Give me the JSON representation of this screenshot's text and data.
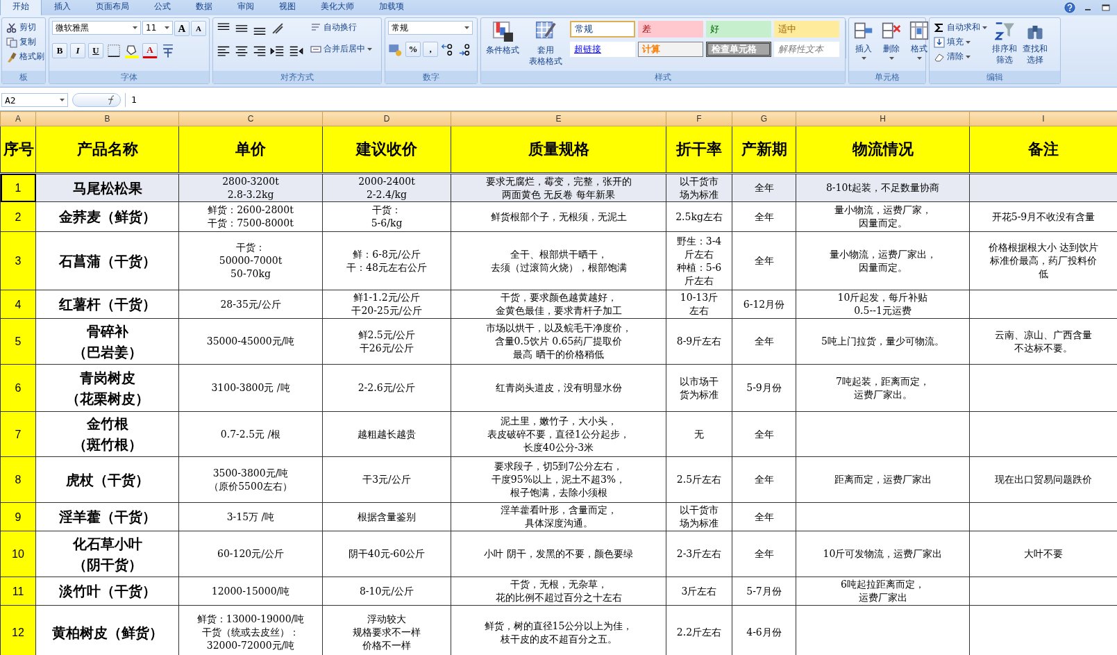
{
  "tabs": [
    {
      "label": "开始",
      "selected": true
    },
    {
      "label": "插入",
      "selected": false
    },
    {
      "label": "页面布局",
      "selected": false
    },
    {
      "label": "公式",
      "selected": false
    },
    {
      "label": "数据",
      "selected": false
    },
    {
      "label": "审阅",
      "selected": false
    },
    {
      "label": "视图",
      "selected": false
    },
    {
      "label": "美化大师",
      "selected": false
    },
    {
      "label": "加载项",
      "selected": false
    }
  ],
  "ribbon": {
    "clipboard": {
      "label": "板",
      "items": [
        "剪切",
        "复制",
        "格式刷"
      ]
    },
    "font": {
      "label": "字体",
      "font": "微软雅黑",
      "size": "11",
      "grow": "A",
      "shrink": "A",
      "bold": "B",
      "italic": "I",
      "underline": "U",
      "font_color": "A"
    },
    "alignment": {
      "label": "对齐方式",
      "wrap": "自动换行",
      "merge": "合并后居中"
    },
    "number": {
      "label": "数字",
      "format": "常规",
      "percent": "%",
      "comma": ","
    },
    "styles": {
      "label": "样式",
      "buttons": [
        [
          "条件格式"
        ],
        [
          "套用",
          "表格格式"
        ]
      ],
      "cells": [
        {
          "label": "常规",
          "kind": "normal"
        },
        {
          "label": "差",
          "kind": "bad"
        },
        {
          "label": "好",
          "kind": "good"
        },
        {
          "label": "适中",
          "kind": "neutral"
        },
        {
          "label": "超链接",
          "kind": "hyperlink"
        },
        {
          "label": "计算",
          "kind": "calculation"
        },
        {
          "label": "检查单元格",
          "kind": "check"
        },
        {
          "label": "解释性文本",
          "kind": "explanatory"
        }
      ]
    },
    "cells": {
      "label": "单元格",
      "buttons": [
        "插入",
        "删除",
        "格式"
      ]
    },
    "editing": {
      "label": "编辑",
      "items": [
        "自动求和",
        "填充",
        "清除"
      ],
      "buttons": [
        [
          "排序和",
          "筛选"
        ],
        [
          "查找和",
          "选择"
        ]
      ]
    }
  },
  "formula_bar": {
    "name_box": "A2",
    "formula": "1"
  },
  "sheet": {
    "column_letters": [
      "A",
      "B",
      "C",
      "D",
      "E",
      "F",
      "G",
      "H",
      "I"
    ],
    "header": [
      "序号",
      "产品名称",
      "单价",
      "建议收价",
      "质量规格",
      "折干率",
      "产新期",
      "物流情况",
      "备注"
    ],
    "rows": [
      {
        "selected": true,
        "cells": [
          [
            "1"
          ],
          [
            "马尾松松果"
          ],
          [
            "2800-3200t",
            "2.8-3.2kg"
          ],
          [
            "2000-2400t",
            "2-2.4/kg"
          ],
          [
            "要求无腐烂，霉变，完整，张开的",
            "两面黄色 无反卷 每年新果"
          ],
          [
            "以干货市",
            "场为标准"
          ],
          [
            "全年"
          ],
          [
            "8-10t起装，不足数量协商"
          ],
          []
        ]
      },
      {
        "selected": false,
        "cells": [
          [
            "2"
          ],
          [
            "金荞麦（鲜货）"
          ],
          [
            "鲜货：2600-2800t",
            "干货：7500-8000t"
          ],
          [
            "干货：",
            "5-6/kg"
          ],
          [
            "鲜货根部个子，无根须，无泥土"
          ],
          [
            "2.5kg左右"
          ],
          [
            "全年"
          ],
          [
            "量小物流，运费厂家，",
            "因量而定。"
          ],
          [
            "开花5-9月不收没有含量"
          ]
        ]
      },
      {
        "selected": false,
        "cells": [
          [
            "3"
          ],
          [
            "石菖蒲（干货）"
          ],
          [
            "干货：",
            "50000-7000t",
            "50-70kg"
          ],
          [
            "鲜：6-8元/公斤",
            "干：48元左右公斤"
          ],
          [
            "全干、根部烘干晒干，",
            "去须（过滚筒火烧），根部饱满"
          ],
          [
            "野生：3-4",
            "斤左右",
            "种植：5-6",
            "斤左右"
          ],
          [
            "全年"
          ],
          [
            "量小物流，运费厂家出，",
            "因量而定。"
          ],
          [
            "价格根据根大小 达到饮片",
            "标准价最高，药厂投料价",
            "低"
          ]
        ]
      },
      {
        "selected": false,
        "cells": [
          [
            "4"
          ],
          [
            "红薯杆（干货）"
          ],
          [
            "28-35元/公斤"
          ],
          [
            "鲜1-1.2元/公斤",
            "干20-25元/公斤"
          ],
          [
            "干货，要求颜色越黄越好，",
            "金黄色最佳，要求青杆子加工"
          ],
          [
            "10-13斤",
            "左右"
          ],
          [
            "6-12月份"
          ],
          [
            "10斤起发，每斤补贴",
            "0.5--1元运费"
          ],
          []
        ]
      },
      {
        "selected": false,
        "cells": [
          [
            "5"
          ],
          [
            "骨碎补",
            "（巴岩姜）"
          ],
          [
            "35000-45000元/吨"
          ],
          [
            "鲜2.5元/公斤",
            "干26元/公斤"
          ],
          [
            "市场以烘干，以及鲩毛干净度价，",
            "含量0.5饮片 0.65药厂提取价",
            "最高 晒干的价格稍低"
          ],
          [
            "8-9斤左右"
          ],
          [
            "全年"
          ],
          [
            "5吨上门拉货，量少可物流。"
          ],
          [
            "云南、凉山、广西含量",
            "不达标不要。"
          ]
        ]
      },
      {
        "selected": false,
        "cells": [
          [
            "6"
          ],
          [
            "青岗树皮",
            "（花栗树皮）"
          ],
          [
            "3100-3800元 /吨"
          ],
          [
            "2-2.6元/公斤"
          ],
          [
            "红青岗头道皮，没有明显水份"
          ],
          [
            "以市场干",
            "货为标准"
          ],
          [
            "5-9月份"
          ],
          [
            "7吨起装，距离而定，",
            "运费厂家出。"
          ],
          []
        ]
      },
      {
        "selected": false,
        "cells": [
          [
            "7"
          ],
          [
            "金竹根",
            "（斑竹根）"
          ],
          [
            "0.7-2.5元 /根"
          ],
          [
            "越粗越长越贵"
          ],
          [
            "泥土里，嫩竹子，大小头，",
            "表皮破碎不要，直径1公分起步，",
            "长度40公分-3米"
          ],
          [
            "无"
          ],
          [
            "全年"
          ],
          [],
          []
        ]
      },
      {
        "selected": false,
        "cells": [
          [
            "8"
          ],
          [
            "虎杖（干货）"
          ],
          [
            "3500-3800元/吨",
            "（原价5500左右）"
          ],
          [
            "干3元/公斤"
          ],
          [
            "要求段子，切5到7公分左右，",
            "干度95%以上，泥土不超3%，",
            "根子饱满，去除小须根"
          ],
          [
            "2.5斤左右"
          ],
          [
            "全年"
          ],
          [
            "距离而定，运费厂家出"
          ],
          [
            "现在出口贸易问题跌价"
          ]
        ]
      },
      {
        "selected": false,
        "cells": [
          [
            "9"
          ],
          [
            "淫羊藿（干货）"
          ],
          [
            "3-15万 /吨"
          ],
          [
            "根据含量鉴别"
          ],
          [
            "淫羊藿看叶形，含量而定，",
            "具体深度沟通。"
          ],
          [
            "以干货市",
            "场为标准"
          ],
          [
            "全年"
          ],
          [],
          []
        ]
      },
      {
        "selected": false,
        "cells": [
          [
            "10"
          ],
          [
            "化石草小叶",
            "（阴干货）"
          ],
          [
            "60-120元/公斤"
          ],
          [
            "阴干40元-60公斤"
          ],
          [
            "小叶 阴干，发黑的不要，颜色要绿"
          ],
          [
            "2-3斤左右"
          ],
          [
            "全年"
          ],
          [
            "10斤可发物流，运费厂家出"
          ],
          [
            "大叶不要"
          ]
        ]
      },
      {
        "selected": false,
        "cells": [
          [
            "11"
          ],
          [
            "淡竹叶（干货）"
          ],
          [
            "12000-15000/吨"
          ],
          [
            "8-10元/公斤"
          ],
          [
            "干货，无根，无杂草，",
            "花的比例不超过百分之十左右"
          ],
          [
            "3斤左右"
          ],
          [
            "5-7月份"
          ],
          [
            "6吨起拉距离而定，",
            "运费厂家出"
          ],
          []
        ]
      },
      {
        "selected": false,
        "cells": [
          [
            "12"
          ],
          [
            "黄柏树皮（鲜货）"
          ],
          [
            "鲜货：13000-19000/吨",
            "干货（统或去皮丝）：",
            "32000-72000元/吨"
          ],
          [
            "浮动较大",
            "规格要求不一样",
            "价格不一样"
          ],
          [
            "鲜货，树的直径15公分以上为佳，",
            "枝干皮的皮不超百分之五。"
          ],
          [
            "2.2斤左右"
          ],
          [
            "4-6月份"
          ],
          [],
          []
        ]
      }
    ]
  }
}
